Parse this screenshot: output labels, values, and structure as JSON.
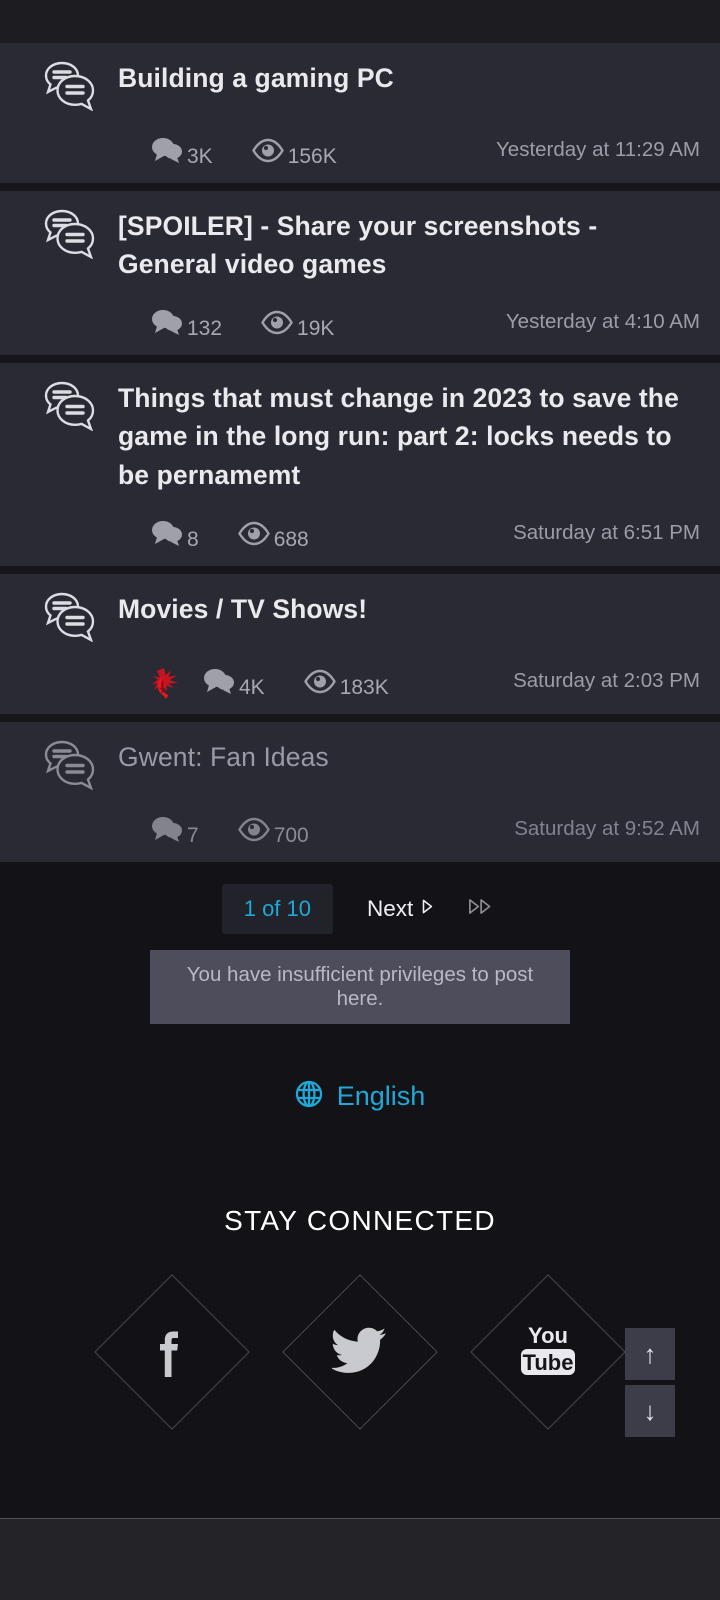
{
  "threads": [
    {
      "title": "Building a gaming PC",
      "icon": "thread-bubbles-icon",
      "read": false,
      "badge": null,
      "replies": "3K",
      "views": "156K",
      "date": "Yesterday at 11:29 AM"
    },
    {
      "title": "[SPOILER] - Share your screenshots - General video games",
      "icon": "thread-bubbles-icon",
      "read": false,
      "badge": null,
      "replies": "132",
      "views": "19K",
      "date": "Yesterday at 4:10 AM"
    },
    {
      "title": "Things that must change in 2023 to save the game in the long run: part 2: locks needs to be pernamemt",
      "icon": "thread-bubbles-icon",
      "read": false,
      "badge": null,
      "replies": "8",
      "views": "688",
      "date": "Saturday at 6:51 PM"
    },
    {
      "title": "Movies / TV Shows!",
      "icon": "thread-bubbles-icon",
      "read": false,
      "badge": "cdpr-red-bird-icon",
      "replies": "4K",
      "views": "183K",
      "date": "Saturday at 2:03 PM"
    },
    {
      "title": "Gwent: Fan Ideas",
      "icon": "thread-bubbles-icon",
      "read": true,
      "badge": null,
      "replies": "7",
      "views": "700",
      "date": "Saturday at 9:52 AM"
    }
  ],
  "pagination": {
    "current_label": "1 of 10",
    "next_label": "Next",
    "last_page_icon": "double-chevron-right-icon"
  },
  "notice": {
    "text": "You have insufficient privileges to post here."
  },
  "language": {
    "icon": "globe-icon",
    "label": "English"
  },
  "footer": {
    "stay_connected_title": "STAY CONNECTED",
    "socials": [
      {
        "name": "facebook-icon",
        "label": "f"
      },
      {
        "name": "twitter-icon",
        "label": ""
      },
      {
        "name": "youtube-icon",
        "label_top": "You",
        "label_bottom": "Tube"
      }
    ]
  },
  "scroll_controls": {
    "up_label": "↑",
    "down_label": "↓"
  },
  "colors": {
    "accent": "#1fa8d8",
    "card_bg": "#292a33",
    "page_bg": "#131317",
    "badge_red": "#d81f26",
    "notice_bg": "#4d4d5c"
  }
}
